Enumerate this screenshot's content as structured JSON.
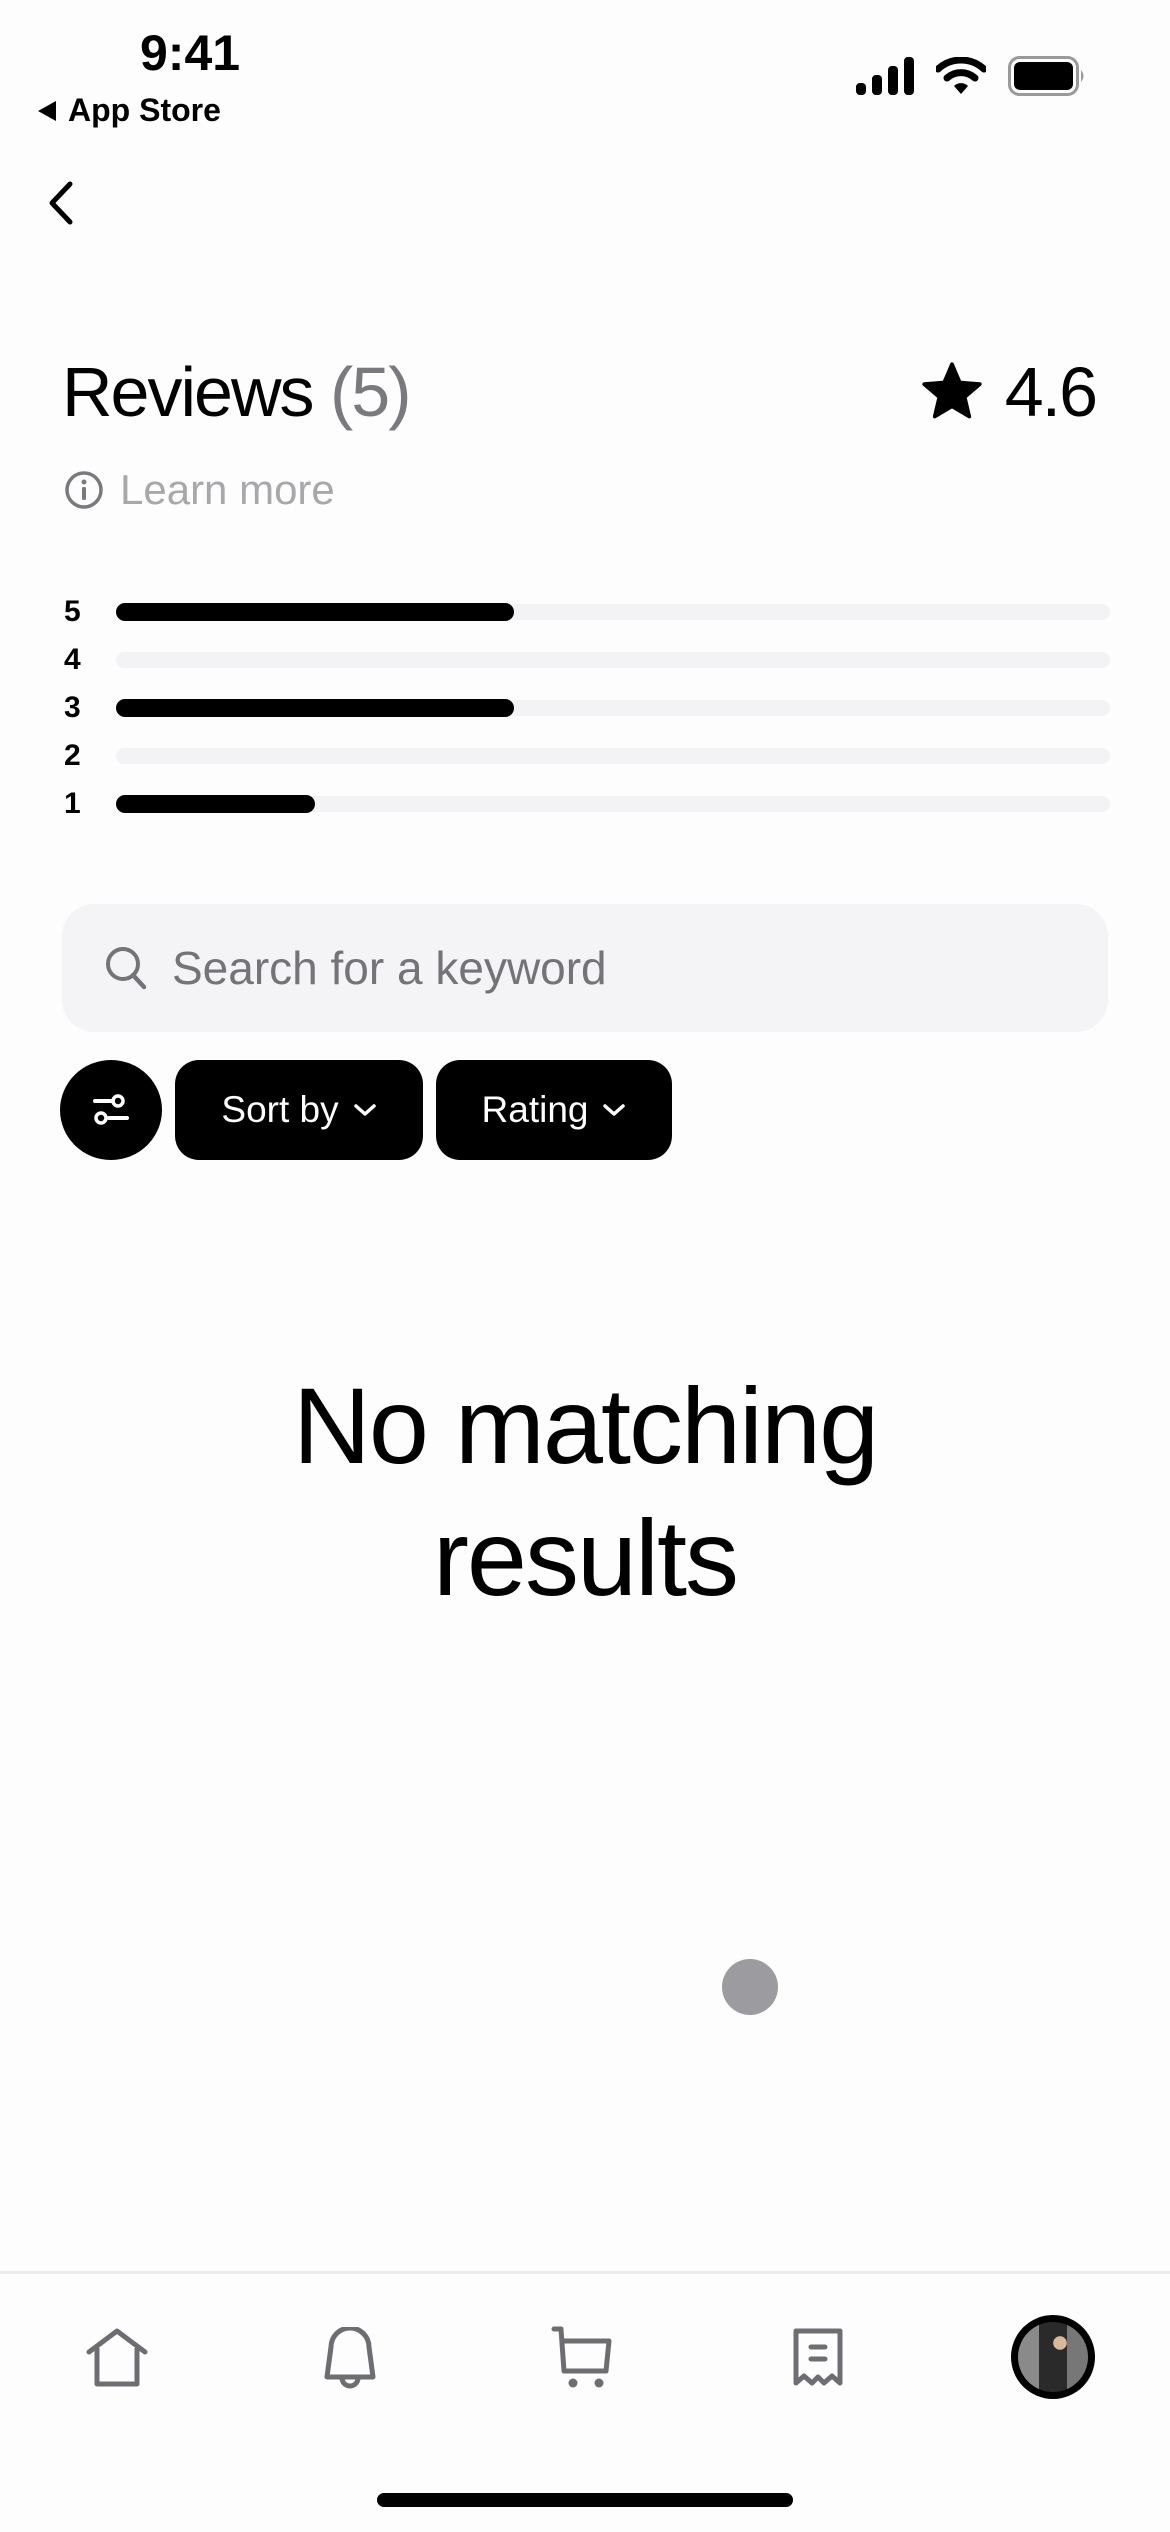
{
  "status_bar": {
    "time": "9:41",
    "back_app": "App Store"
  },
  "header": {
    "title": "Reviews",
    "count": "(5)",
    "average_rating": "4.6",
    "learn_more": "Learn more"
  },
  "distribution": [
    {
      "stars": "5",
      "fraction": 0.4
    },
    {
      "stars": "4",
      "fraction": 0
    },
    {
      "stars": "3",
      "fraction": 0.4
    },
    {
      "stars": "2",
      "fraction": 0
    },
    {
      "stars": "1",
      "fraction": 0.2
    }
  ],
  "search": {
    "placeholder": "Search for a keyword",
    "value": ""
  },
  "filters": {
    "sort_label": "Sort by",
    "rating_label": "Rating"
  },
  "empty_state": {
    "line1": "No matching",
    "line2": "results"
  },
  "tab_bar": {
    "items": [
      {
        "icon": "home-icon"
      },
      {
        "icon": "bell-icon"
      },
      {
        "icon": "cart-icon"
      },
      {
        "icon": "receipt-icon"
      },
      {
        "icon": "profile-avatar"
      }
    ]
  },
  "colors": {
    "accent": "#000000",
    "muted_text": "#7a7a7e",
    "placeholder": "#737378",
    "track": "#f3f3f5",
    "icon_gray": "#6e6e72"
  }
}
